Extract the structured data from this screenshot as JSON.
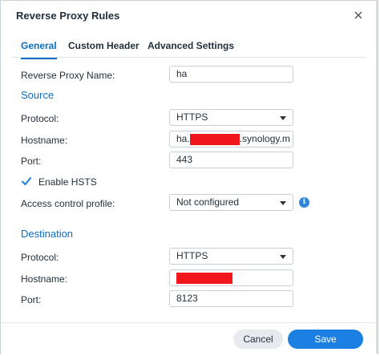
{
  "dialog": {
    "title": "Reverse Proxy Rules",
    "close_icon": "close-icon"
  },
  "tabs": [
    {
      "label": "General",
      "active": true
    },
    {
      "label": "Custom Header",
      "active": false
    },
    {
      "label": "Advanced Settings",
      "active": false
    }
  ],
  "general": {
    "name_label": "Reverse Proxy Name:",
    "name_value": "ha"
  },
  "source": {
    "heading": "Source",
    "protocol_label": "Protocol:",
    "protocol_value": "HTTPS",
    "hostname_label": "Hostname:",
    "hostname_prefix": "ha.",
    "hostname_suffix": ".synology.m",
    "port_label": "Port:",
    "port_value": "443",
    "hsts_label": "Enable HSTS",
    "hsts_checked": true,
    "acl_label": "Access control profile:",
    "acl_value": "Not configured",
    "info_icon": "info-icon"
  },
  "destination": {
    "heading": "Destination",
    "protocol_label": "Protocol:",
    "protocol_value": "HTTPS",
    "hostname_label": "Hostname:",
    "port_label": "Port:",
    "port_value": "8123"
  },
  "footer": {
    "cancel_label": "Cancel",
    "save_label": "Save"
  },
  "colors": {
    "accent": "#0b6ec4",
    "primary_button": "#1c80e3",
    "redaction": "#f0161c"
  }
}
